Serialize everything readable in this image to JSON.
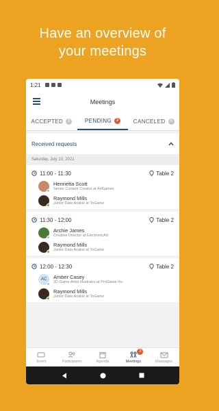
{
  "headline": {
    "line1": "Have an overview of",
    "line2": "your meetings"
  },
  "status_bar": {
    "time": "1:21"
  },
  "app_bar": {
    "title": "Meetings"
  },
  "tabs": [
    {
      "label": "ACCEPTED",
      "count": "0",
      "active": false
    },
    {
      "label": "PENDING",
      "count": "3",
      "active": true
    },
    {
      "label": "CANCELED",
      "count": "5",
      "active": false
    }
  ],
  "section": {
    "title": "Received requests"
  },
  "date": "Saturday, July 10, 2021",
  "meetings": [
    {
      "time": "11:00 - 11:30",
      "location": "Table 2",
      "requester": {
        "name": "Henrietta Scott",
        "role": "Senior Content Creator at ArtGames"
      },
      "recipient": {
        "name": "Raymond Mills",
        "role": "Junior Data Analist at ToGame"
      }
    },
    {
      "time": "11:30 - 12:00",
      "location": "Table 2",
      "requester": {
        "name": "Archie James",
        "role": "Creative Director at ElectronicArt"
      },
      "recipient": {
        "name": "Raymond Mills",
        "role": "Junior Data Analist at ToGame"
      }
    },
    {
      "time": "12:00 - 12:30",
      "location": "Table 2",
      "requester": {
        "name": "Amber Casey",
        "role": "2D Game Artist Illustrator at ProGame Inc.",
        "initials": "AC"
      },
      "recipient": {
        "name": "Raymond Mills",
        "role": "Junior Data Analist at ToGame"
      }
    }
  ],
  "bottom_nav": [
    {
      "label": "Event",
      "icon": "ticket-icon"
    },
    {
      "label": "Participants",
      "icon": "people-icon"
    },
    {
      "label": "Agenda",
      "icon": "calendar-icon"
    },
    {
      "label": "Meetings",
      "icon": "meetings-icon",
      "badge": "3",
      "active": true
    },
    {
      "label": "Messages",
      "icon": "mail-icon"
    }
  ],
  "colors": {
    "background": "#eda321",
    "primary": "#2a4d6e",
    "badge": "#e4572e",
    "online": "#6bbf3a"
  }
}
